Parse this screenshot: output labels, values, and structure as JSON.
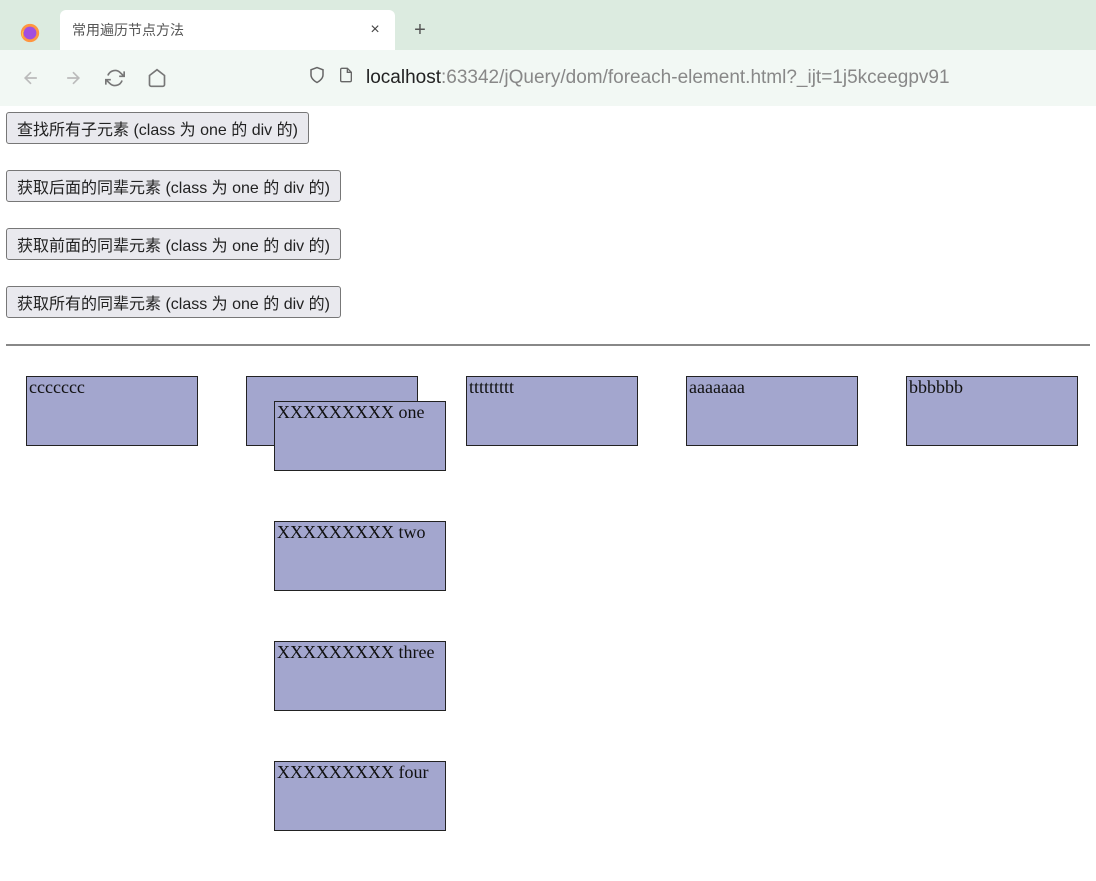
{
  "browser": {
    "tab_title": "常用遍历节点方法",
    "url_host": "localhost",
    "url_path": ":63342/jQuery/dom/foreach-element.html?_ijt=1j5kceegpv91"
  },
  "buttons": {
    "b1": "查找所有子元素 (class 为 one 的 div 的)",
    "b2": "获取后面的同辈元素 (class 为 one 的 div 的)",
    "b3": "获取前面的同辈元素 (class 为 one 的 div 的)",
    "b4": "获取所有的同辈元素 (class 为 one 的 div 的)"
  },
  "boxes": {
    "cc": "ccccccc",
    "tt": "ttttttttt",
    "aa": "aaaaaaa",
    "bb": "bbbbbb",
    "child1": "XXXXXXXXX one",
    "child2": "XXXXXXXXX two",
    "child3": "XXXXXXXXX three",
    "child4": "XXXXXXXXX four"
  }
}
